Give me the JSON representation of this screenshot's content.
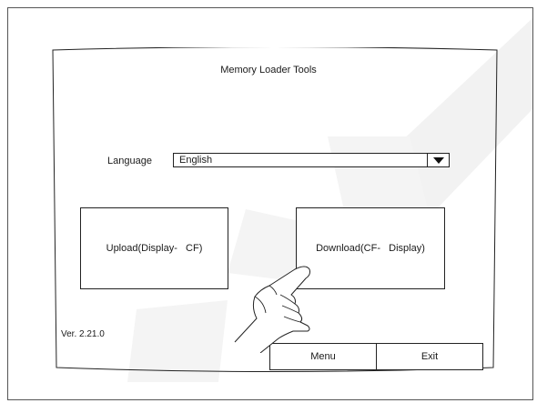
{
  "screen": {
    "title": "Memory Loader Tools",
    "language": {
      "label": "Language",
      "selected": "English"
    },
    "upload_label": "Upload(Display-   CF)",
    "download_label": "Download(CF-   Display)",
    "version": "Ver. 2.21.0",
    "menu_label": "Menu",
    "exit_label": "Exit"
  },
  "icons": {
    "dropdown": "triangle-down-icon",
    "hand": "pointing-hand-icon"
  },
  "colors": {
    "line": "#222222",
    "watermark": "#f2f2f2"
  }
}
